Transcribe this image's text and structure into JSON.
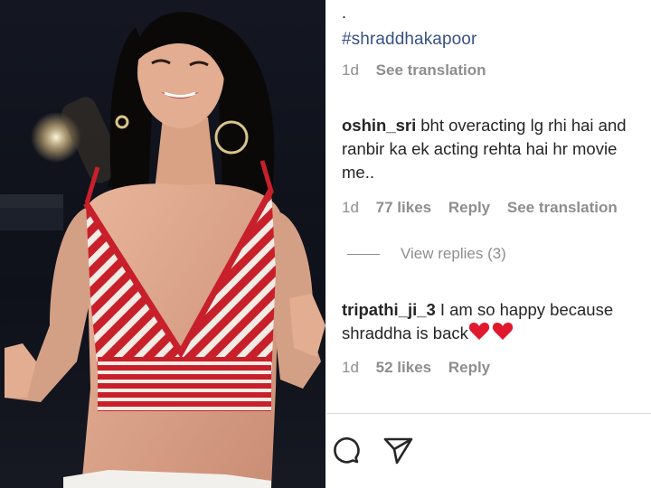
{
  "post": {
    "caption_dot": ".",
    "hashtag": "#shraddhakapoor",
    "time": "1d",
    "see_translation": "See translation"
  },
  "comments": [
    {
      "username": "oshin_sri",
      "text": "bht overacting lg rhi hai and ranbir ka ek acting rehta hai hr movie me..",
      "time": "1d",
      "likes": "77 likes",
      "reply": "Reply",
      "see_translation": "See translation",
      "view_replies": "View replies (3)"
    },
    {
      "username": "tripathi_ji_3",
      "text": "I am so happy because shraddha is back",
      "emoji": "red-heart x2",
      "time": "1d",
      "likes": "52 likes",
      "reply": "Reply"
    }
  ],
  "actions": {
    "comment_icon": "comment-icon",
    "share_icon": "share-paper-plane-icon"
  },
  "colors": {
    "hashtag": "#385185",
    "muted": "#8e8e8e",
    "text": "#262626",
    "heart": "#e0192f"
  }
}
